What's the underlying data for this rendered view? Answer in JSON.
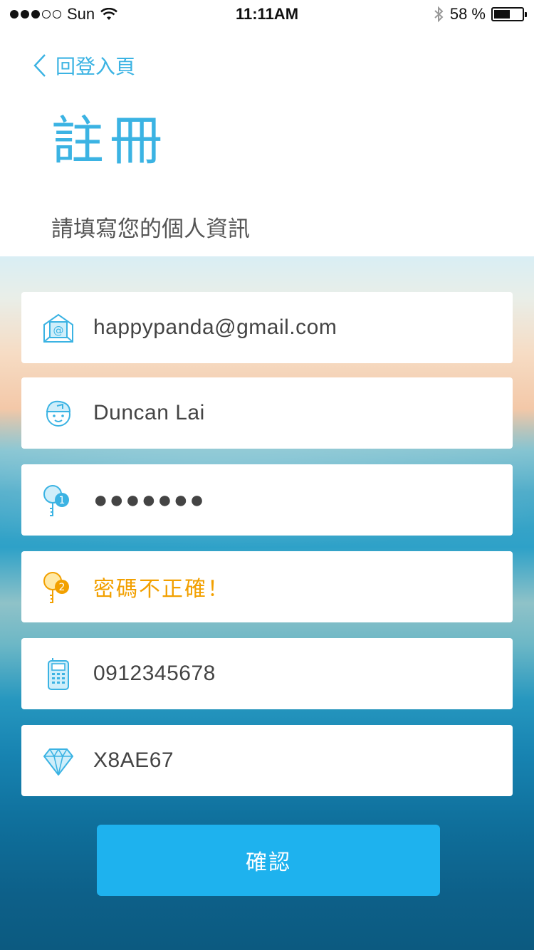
{
  "status_bar": {
    "carrier": "Sun",
    "time": "11:11AM",
    "battery_percent": "58 %",
    "battery_level": 0.58
  },
  "header": {
    "back_label": "回登入頁",
    "title": "註冊",
    "subtitle": "請填寫您的個人資訊"
  },
  "form": {
    "email": {
      "value": "happypanda@gmail.com",
      "icon": "mail-icon"
    },
    "name": {
      "value": "Duncan Lai",
      "icon": "user-icon"
    },
    "password": {
      "value": "●●●●●●●",
      "icon": "key-1-icon",
      "badge": "1"
    },
    "password_confirm": {
      "value": "密碼不正確！",
      "icon": "key-2-icon",
      "badge": "2",
      "state_color": "#f2a000"
    },
    "phone": {
      "value": "0912345678",
      "icon": "phone-icon"
    },
    "invite_code": {
      "value": "X8AE67",
      "icon": "diamond-icon"
    }
  },
  "confirm_button": {
    "label": "確認"
  },
  "colors": {
    "accent": "#3bb3e3",
    "button": "#1eb2ee",
    "error": "#f2a000"
  }
}
